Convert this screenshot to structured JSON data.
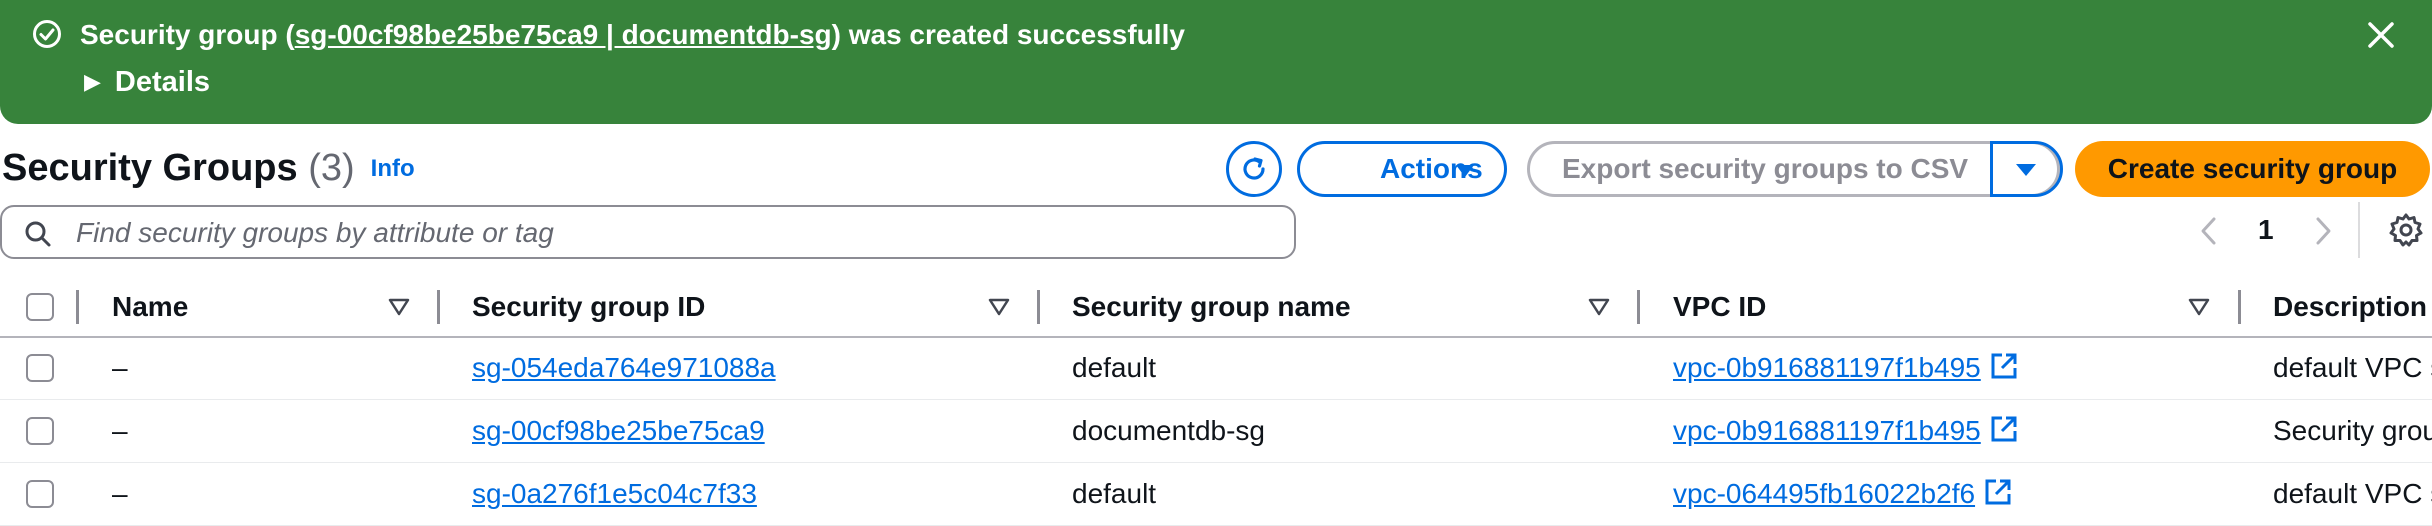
{
  "flash": {
    "message_prefix": "Security group (",
    "message_link": "sg-00cf98be25be75ca9 | documentdb-sg",
    "message_suffix": ") was created successfully",
    "details_label": "Details"
  },
  "header": {
    "title": "Security Groups",
    "count": "(3)",
    "info_label": "Info",
    "actions_label": "Actions",
    "export_label": "Export security groups to CSV",
    "create_label": "Create security group"
  },
  "search": {
    "placeholder": "Find security groups by attribute or tag",
    "value": ""
  },
  "pagination": {
    "current_page": "1"
  },
  "table": {
    "columns": [
      "Name",
      "Security group ID",
      "Security group name",
      "VPC ID",
      "Description"
    ],
    "rows": [
      {
        "name": "–",
        "id": "sg-054eda764e971088a",
        "group_name": "default",
        "vpc": "vpc-0b916881197f1b495",
        "description": "default VPC s"
      },
      {
        "name": "–",
        "id": "sg-00cf98be25be75ca9",
        "group_name": "documentdb-sg",
        "vpc": "vpc-0b916881197f1b495",
        "description": "Security grou"
      },
      {
        "name": "–",
        "id": "sg-0a276f1e5c04c7f33",
        "group_name": "default",
        "vpc": "vpc-064495fb16022b2f6",
        "description": "default VPC s"
      }
    ]
  },
  "colors": {
    "success": "#37833b",
    "link": "#006ce0",
    "primary": "#ff9900"
  }
}
